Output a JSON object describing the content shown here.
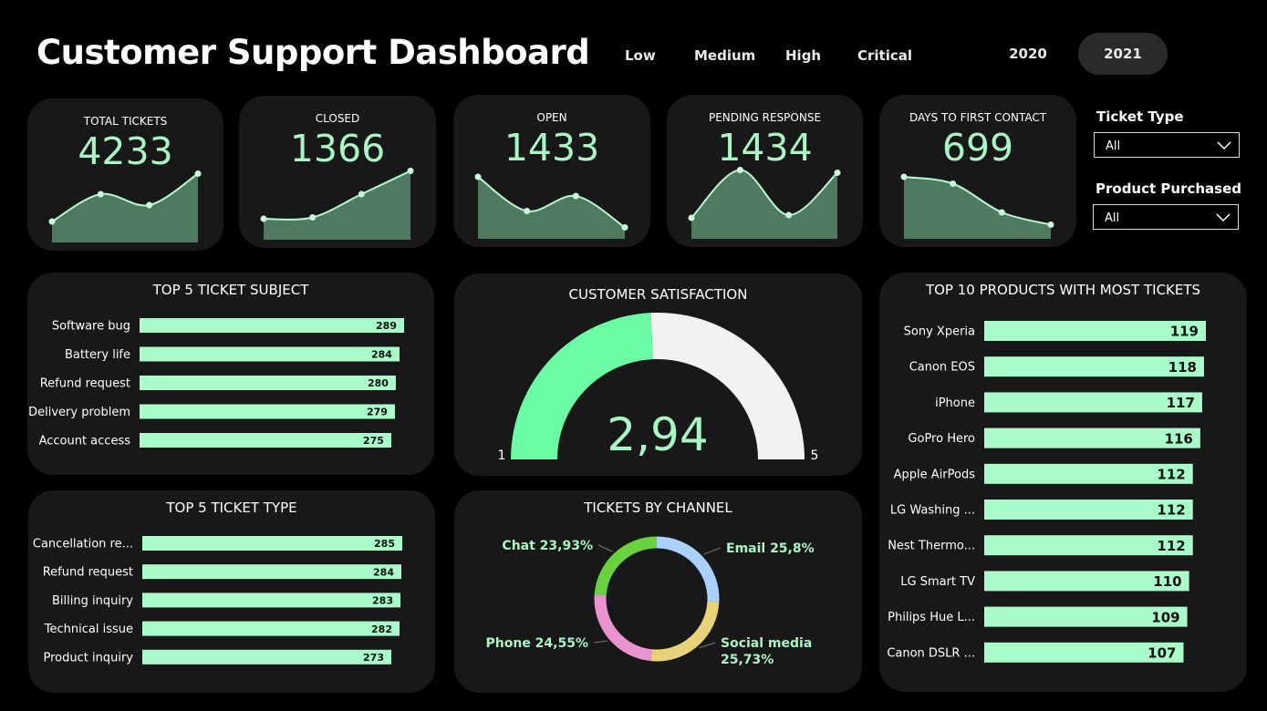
{
  "header": {
    "title": "Customer Support Dashboard",
    "priorities": [
      "Low",
      "Medium",
      "High",
      "Critical"
    ],
    "years": [
      {
        "label": "2020",
        "selected": false
      },
      {
        "label": "2021",
        "selected": true
      }
    ]
  },
  "kpis": [
    {
      "label": "TOTAL TICKETS",
      "value": "4233",
      "trend": [
        1,
        3,
        2.2,
        4.5
      ]
    },
    {
      "label": "CLOSED",
      "value": "1366",
      "trend": [
        1,
        1.1,
        2.8,
        4.5
      ]
    },
    {
      "label": "OPEN",
      "value": "1433",
      "trend": [
        4,
        1.5,
        2.6,
        0.3
      ]
    },
    {
      "label": "PENDING RESPONSE",
      "value": "1434",
      "trend": [
        1,
        4.5,
        1.2,
        4.3
      ]
    },
    {
      "label": "DAYS TO FIRST CONTACT",
      "value": "699",
      "trend": [
        4,
        3.5,
        1.4,
        0.5
      ]
    }
  ],
  "slicers": [
    {
      "label": "Ticket Type",
      "value": "All"
    },
    {
      "label": "Product Purchased",
      "value": "All"
    }
  ],
  "colors": {
    "bar": "#a9fcc9",
    "accent": "#a9f5c4",
    "card": "#181818",
    "gauge_fill": "#6bfba4",
    "gauge_rest": "#f2f2f2"
  },
  "chart_data": [
    {
      "type": "bar",
      "orientation": "horizontal",
      "title": "TOP 5 TICKET SUBJECT",
      "categories": [
        "Software bug",
        "Battery life",
        "Refund request",
        "Delivery problem",
        "Account access"
      ],
      "values": [
        289,
        284,
        280,
        279,
        275
      ]
    },
    {
      "type": "bar",
      "orientation": "horizontal",
      "title": "TOP 5 TICKET TYPE",
      "categories": [
        "Cancellation re...",
        "Refund request",
        "Billing inquiry",
        "Technical issue",
        "Product inquiry"
      ],
      "values": [
        285,
        284,
        283,
        282,
        273
      ]
    },
    {
      "type": "gauge",
      "title": "CUSTOMER SATISFACTION",
      "value": 2.94,
      "value_label": "2,94",
      "min": 1,
      "max": 5
    },
    {
      "type": "pie",
      "title": "TICKETS BY CHANNEL",
      "series": [
        {
          "name": "Email",
          "value": 25.8,
          "label": "25,8%",
          "color": "#a9d1fb"
        },
        {
          "name": "Social media",
          "value": 25.73,
          "label": "25,73%",
          "color": "#e8d27a"
        },
        {
          "name": "Phone",
          "value": 24.55,
          "label": "24,55%",
          "color": "#ea94cf"
        },
        {
          "name": "Chat",
          "value": 23.93,
          "label": "23,93%",
          "color": "#6ad13f"
        }
      ]
    },
    {
      "type": "bar",
      "orientation": "horizontal",
      "title": "TOP 10 PRODUCTS WITH MOST TICKETS",
      "categories": [
        "Sony Xperia",
        "Canon EOS",
        "iPhone",
        "GoPro Hero",
        "Apple AirPods",
        "LG Washing ...",
        "Nest Thermo...",
        "LG Smart TV",
        "Philips Hue L...",
        "Canon DSLR ..."
      ],
      "values": [
        119,
        118,
        117,
        116,
        112,
        112,
        112,
        110,
        109,
        107
      ]
    }
  ]
}
